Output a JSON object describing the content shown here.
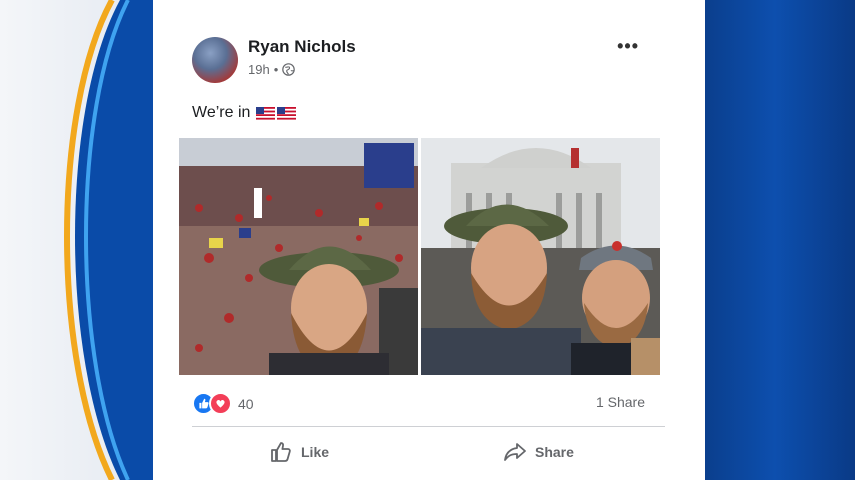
{
  "post": {
    "author": "Ryan Nichols",
    "time": "19h",
    "separator": "•",
    "text": "We’re in",
    "reaction_count": "40",
    "share_count": "1 Share"
  },
  "actions": {
    "like_label": "Like",
    "share_label": "Share"
  },
  "icons": {
    "more": "more-options-icon",
    "audience": "globe-icon",
    "flags": "us-flag-emoji",
    "reactions": [
      "like-reaction-icon",
      "love-reaction-icon"
    ]
  },
  "colors": {
    "facebook_blue": "#1877f2",
    "love_red": "#f33e58",
    "secondary_text": "#65676b"
  }
}
